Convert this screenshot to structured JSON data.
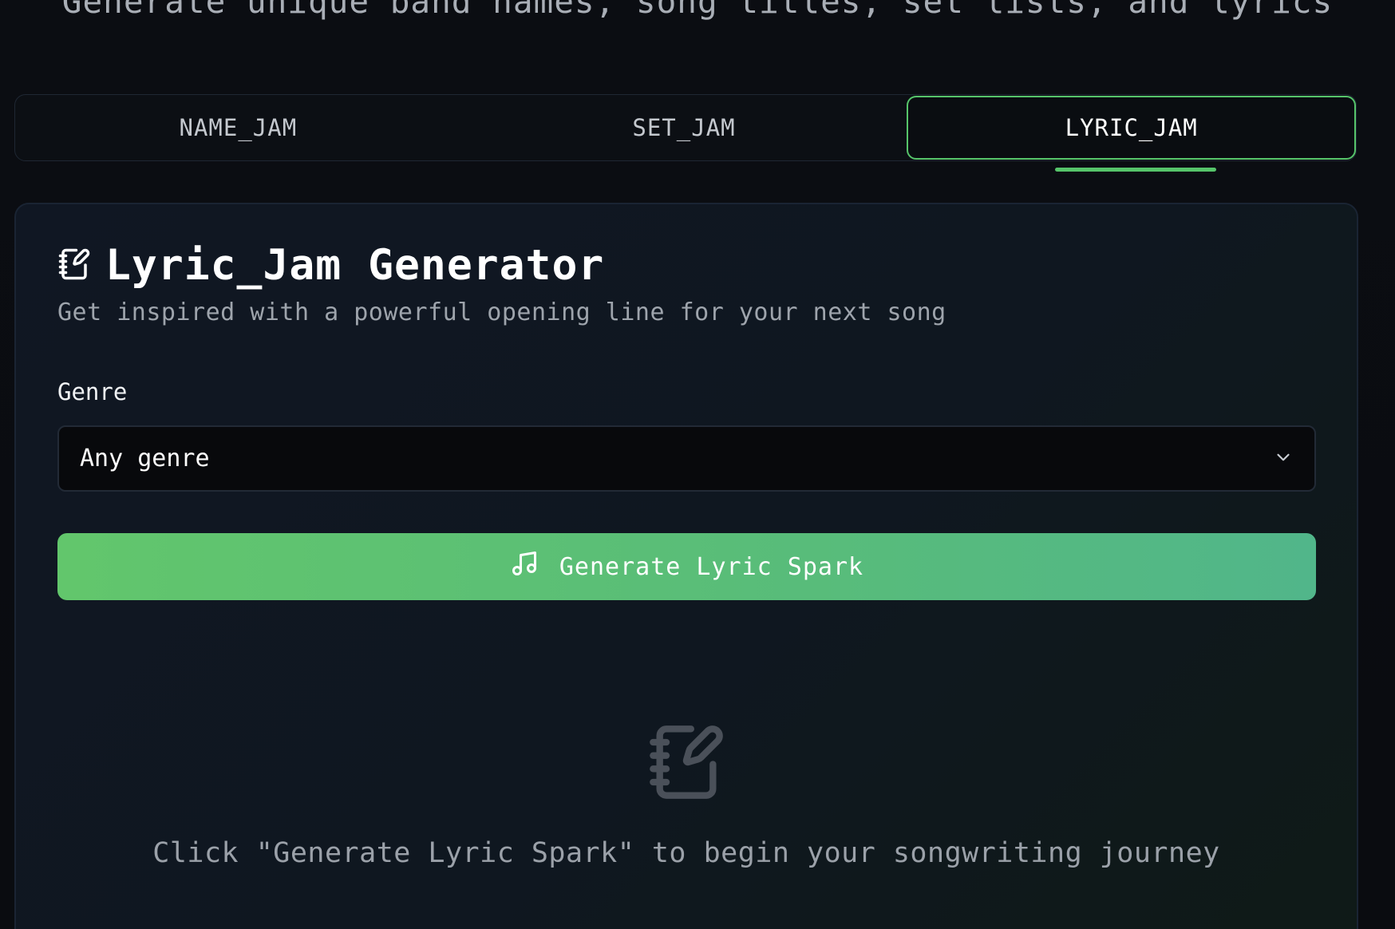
{
  "header": {
    "subtitle": "Generate unique band names, song titles, set lists, and lyrics"
  },
  "tabs": [
    {
      "label": "NAME_JAM",
      "active": false
    },
    {
      "label": "SET_JAM",
      "active": false
    },
    {
      "label": "LYRIC_JAM",
      "active": true
    }
  ],
  "card": {
    "icon": "notebook-pen-icon",
    "title": "Lyric_Jam Generator",
    "description": "Get inspired with a powerful opening line for your next song"
  },
  "form": {
    "genre_label": "Genre",
    "genre_selected": "Any genre"
  },
  "button": {
    "icon": "music-note-icon",
    "label": "Generate Lyric Spark"
  },
  "empty_state": {
    "icon": "notebook-pen-icon",
    "message": "Click \"Generate Lyric Spark\" to begin your songwriting journey"
  },
  "colors": {
    "accent": "#56c46a",
    "button_start": "#62c66c",
    "button_end": "#51b68a"
  }
}
